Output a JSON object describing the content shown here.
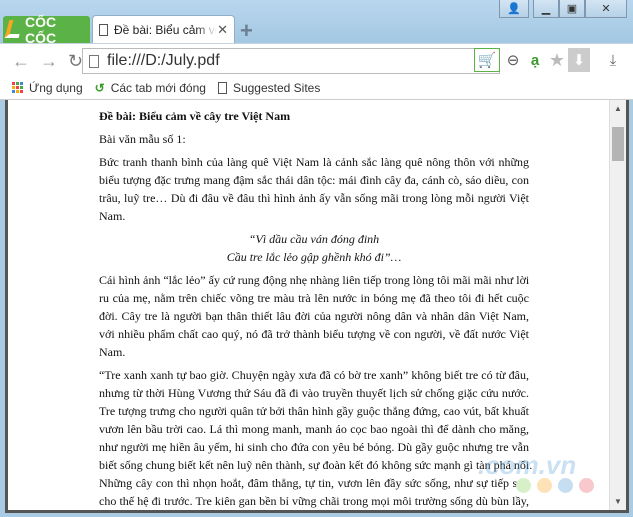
{
  "browser": {
    "logo_text": "CỐC CỐC",
    "tab_title": "Đề bài: Biểu cảm về cây tre Việt Nam",
    "address": "file:///D:/July.pdf",
    "bookmarks": [
      {
        "label": "Ứng dụng",
        "icon": "apps-grid-icon"
      },
      {
        "label": "Các tab mới đóng",
        "icon": "history-icon"
      },
      {
        "label": "Suggested Sites",
        "icon": "page-icon"
      }
    ],
    "accent": "#5bb246"
  },
  "document": {
    "title": "Đề bài: Biểu cảm về cây tre Việt Nam",
    "subtitle": "Bài văn mẫu số 1:",
    "para1": [
      "Bức tranh thanh bình của làng quê Việt Nam là cảnh sắc làng quê nông thôn với những",
      "biểu tượng đặc trưng mang đậm sắc thái dân tộc: mái đình cây đa, cánh cò, sáo diều, con",
      "trâu, luỹ tre… Dù đi đâu về đâu thì hình ảnh ấy vẫn sống mãi trong lòng mỗi người Việt",
      "Nam."
    ],
    "verse": [
      "“Vì dầu cầu ván đóng đinh",
      "Cầu tre lắc lẻo gập ghềnh khó đi”…"
    ],
    "para2": [
      "Cái hình ảnh “lắc lẻo” ấy cứ rung động nhẹ nhàng liên tiếp trong lòng tôi mãi mãi như lời",
      "ru của mẹ, nằm trên chiếc võng tre màu trà lên nước in bóng mẹ đã theo tôi đi hết cuộc",
      "đời. Cây tre là người bạn thân thiết lâu đời của người nông dân và nhân dân Việt Nam,",
      "với nhiều phẩm chất cao quý, nó đã trở thành biểu tượng về con người, về đất nước Việt",
      "Nam."
    ],
    "para3": [
      "“Tre xanh xanh tự bao giờ. Chuyện ngày xưa đã có bờ tre xanh” không biết tre có từ đâu,",
      "nhưng từ thời Hùng Vương thứ Sáu đã đi vào truyền thuyết lịch sử chống giặc cứu nước.",
      "Tre tượng trưng cho người quân tử bởi thân hình gầy guộc thẳng đứng, cao vút, bất khuất",
      "vươn lên bầu trời cao. Lá thì mong manh, manh áo cọc bao ngoài thì để dành cho măng,",
      "như người mẹ hiền âu yếm, hi sinh cho đứa con yêu bé bỏng. Dù gầy guộc nhưng tre vẫn",
      "biết sống chung biết kết nên luỹ nên thành, sự đoàn kết đó không sức mạnh gì tàn phá nổi.",
      "Những cây con thì nhọn hoắt, đâm thẳng, tự tin, vươn lên đầy sức sống, như sự tiếp sức",
      "cho thế hệ đi trước. Tre kiên gan bền bỉ vững chãi trong mọi môi trường sống dù bùn lầy,"
    ]
  },
  "watermark": "Download.com.vn"
}
